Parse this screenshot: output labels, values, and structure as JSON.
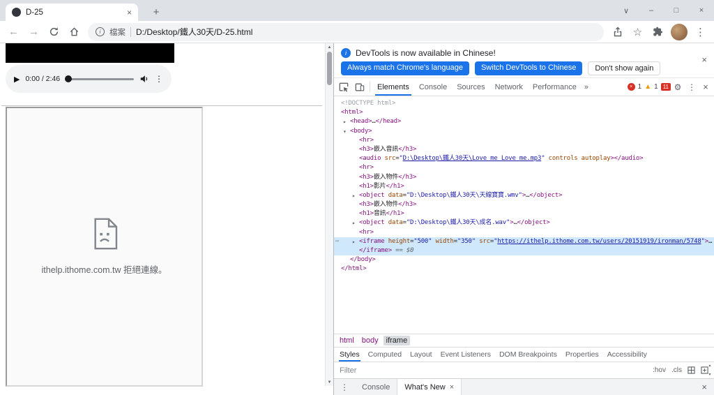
{
  "colors": {
    "accent_blue": "#1a73e8",
    "selection_blue": "#cfe8fc",
    "tag_purple": "#881280",
    "attr_brown": "#994500",
    "value_blue": "#1a1aa6",
    "error_red": "#d93025",
    "warning_yellow": "#f29900"
  },
  "icons": {
    "close": "×",
    "plus": "+",
    "chevron_down": "∨",
    "minimize": "–",
    "maximize": "□",
    "back": "←",
    "forward": "→",
    "star": "☆",
    "menu": "⋮",
    "gear": "⚙",
    "overflow_chevrons": "»",
    "play": "▶",
    "up_arrow": "▲",
    "down_arrow": "▼",
    "info": "i"
  },
  "window": {
    "tab_title": "D-25"
  },
  "navbar": {
    "file_label": "檔案",
    "url": "D:/Desktop/鐵人30天/D-25.html"
  },
  "page": {
    "audio": {
      "time": "0:00 / 2:46"
    },
    "iframe_error": "ithelp.ithome.com.tw 拒絕連線。"
  },
  "devtools": {
    "notification": {
      "message": "DevTools is now available in Chinese!",
      "buttons": [
        {
          "label": "Always match Chrome's language"
        },
        {
          "label": "Switch DevTools to Chinese"
        },
        {
          "label": "Don't show again"
        }
      ]
    },
    "toolbar": {
      "tabs": [
        "Elements",
        "Console",
        "Sources",
        "Network",
        "Performance"
      ],
      "errors": "1",
      "warnings": "1",
      "issues": "11"
    },
    "tree": {
      "lines": [
        {
          "indent": 0,
          "tokens": [
            [
              "doc",
              "<!DOCTYPE html>"
            ]
          ]
        },
        {
          "indent": 0,
          "tokens": [
            [
              "tag",
              "<html>"
            ]
          ]
        },
        {
          "indent": 1,
          "arrow": "right",
          "tokens": [
            [
              "tag",
              "<head>"
            ],
            [
              "plain",
              "…"
            ],
            [
              "tag",
              "</head>"
            ]
          ]
        },
        {
          "indent": 1,
          "arrow": "down",
          "tokens": [
            [
              "tag",
              "<body>"
            ]
          ]
        },
        {
          "indent": 2,
          "tokens": [
            [
              "tag",
              "<hr>"
            ]
          ]
        },
        {
          "indent": 2,
          "tokens": [
            [
              "tag",
              "<h3>"
            ],
            [
              "plain",
              "嵌入音訊"
            ],
            [
              "tag",
              "</h3>"
            ]
          ]
        },
        {
          "indent": 2,
          "tokens": [
            [
              "tag",
              "<audio"
            ],
            [
              "plain",
              " "
            ],
            [
              "attr",
              "src"
            ],
            [
              "plain",
              "="
            ],
            [
              "val",
              "\""
            ],
            [
              "link",
              "D:\\Desktop\\鐵人30天\\Love_me_Love_me.mp3"
            ],
            [
              "val",
              "\""
            ],
            [
              "plain",
              " "
            ],
            [
              "attr",
              "controls"
            ],
            [
              "plain",
              " "
            ],
            [
              "attr",
              "autoplay"
            ],
            [
              "tag",
              "></audio>"
            ]
          ]
        },
        {
          "indent": 2,
          "tokens": [
            [
              "tag",
              "<hr>"
            ]
          ]
        },
        {
          "indent": 2,
          "tokens": [
            [
              "tag",
              "<h3>"
            ],
            [
              "plain",
              "嵌入物件"
            ],
            [
              "tag",
              "</h3>"
            ]
          ]
        },
        {
          "indent": 2,
          "tokens": [
            [
              "tag",
              "<h1>"
            ],
            [
              "plain",
              "影片"
            ],
            [
              "tag",
              "</h1>"
            ]
          ]
        },
        {
          "indent": 2,
          "arrow": "right",
          "tokens": [
            [
              "tag",
              "<object"
            ],
            [
              "plain",
              " "
            ],
            [
              "attr",
              "data"
            ],
            [
              "plain",
              "="
            ],
            [
              "val",
              "\"D:\\Desktop\\鐵人30天\\天線寶寶.wmv\""
            ],
            [
              "tag",
              ">"
            ],
            [
              "plain",
              "…"
            ],
            [
              "tag",
              "</object>"
            ]
          ]
        },
        {
          "indent": 2,
          "tokens": [
            [
              "tag",
              "<h3>"
            ],
            [
              "plain",
              "嵌入物件"
            ],
            [
              "tag",
              "</h3>"
            ]
          ]
        },
        {
          "indent": 2,
          "tokens": [
            [
              "tag",
              "<h1>"
            ],
            [
              "plain",
              "音訊"
            ],
            [
              "tag",
              "</h1>"
            ]
          ]
        },
        {
          "indent": 2,
          "arrow": "right",
          "tokens": [
            [
              "tag",
              "<object"
            ],
            [
              "plain",
              " "
            ],
            [
              "attr",
              "data"
            ],
            [
              "plain",
              "="
            ],
            [
              "val",
              "\"D:\\Desktop\\鐵人30天\\成名.wav\""
            ],
            [
              "tag",
              ">"
            ],
            [
              "plain",
              "…"
            ],
            [
              "tag",
              "</object>"
            ]
          ]
        },
        {
          "indent": 2,
          "tokens": [
            [
              "tag",
              "<hr>"
            ]
          ]
        },
        {
          "indent": 2,
          "arrow": "right",
          "selected": true,
          "gutter": "⋯",
          "tokens": [
            [
              "tag",
              "<iframe"
            ],
            [
              "plain",
              " "
            ],
            [
              "attr",
              "height"
            ],
            [
              "plain",
              "="
            ],
            [
              "val",
              "\"500\""
            ],
            [
              "plain",
              " "
            ],
            [
              "attr",
              "width"
            ],
            [
              "plain",
              "="
            ],
            [
              "val",
              "\"350\""
            ],
            [
              "plain",
              " "
            ],
            [
              "attr",
              "src"
            ],
            [
              "plain",
              "="
            ],
            [
              "val",
              "\""
            ],
            [
              "link",
              "https://ithelp.ithome.com.tw/users/20151919/ironman/5748"
            ],
            [
              "val",
              "\""
            ],
            [
              "tag",
              ">"
            ],
            [
              "plain",
              "…"
            ]
          ]
        },
        {
          "indent": 2,
          "selected": true,
          "tokens": [
            [
              "tag",
              "</iframe>"
            ],
            [
              "meta",
              " == $0"
            ]
          ]
        },
        {
          "indent": 1,
          "tokens": [
            [
              "tag",
              "</body>"
            ]
          ]
        },
        {
          "indent": 0,
          "tokens": [
            [
              "tag",
              "</html>"
            ]
          ]
        }
      ]
    },
    "breadcrumbs": [
      {
        "label": "html"
      },
      {
        "label": "body"
      },
      {
        "label": "iframe"
      }
    ],
    "sidebar_tabs": [
      "Styles",
      "Computed",
      "Layout",
      "Event Listeners",
      "DOM Breakpoints",
      "Properties",
      "Accessibility"
    ],
    "filter": {
      "placeholder": "Filter",
      "toggles": [
        ":hov",
        ".cls"
      ]
    },
    "drawer": {
      "tabs": [
        "Console",
        "What's New"
      ]
    }
  }
}
